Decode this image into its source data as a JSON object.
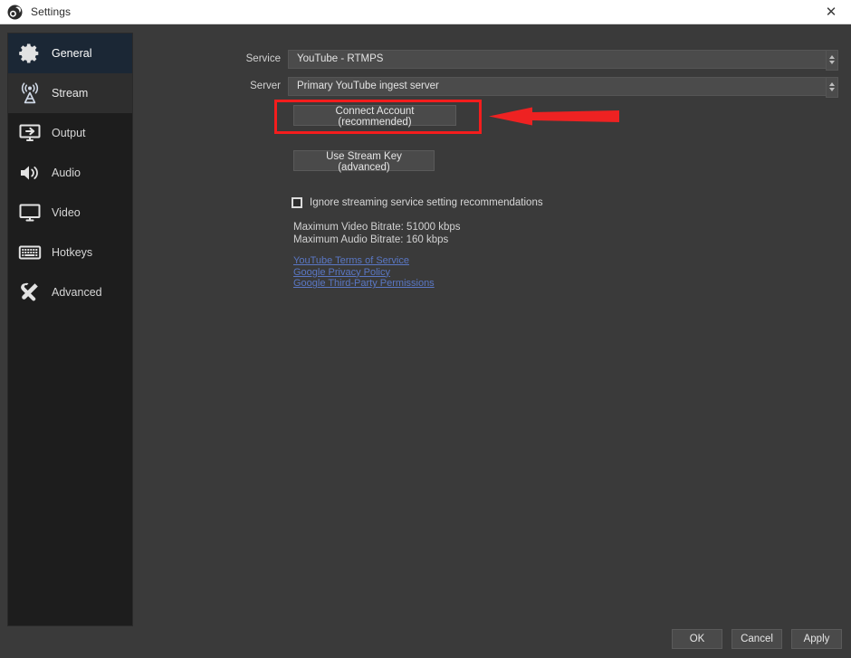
{
  "window": {
    "title": "Settings",
    "logo_icon": "obs-logo-icon",
    "close_icon": "close-icon"
  },
  "sidebar": {
    "items": [
      {
        "label": "General",
        "icon": "gear-icon",
        "state": "selected"
      },
      {
        "label": "Stream",
        "icon": "broadcast-icon",
        "state": "hovered"
      },
      {
        "label": "Output",
        "icon": "output-monitor-icon",
        "state": "normal"
      },
      {
        "label": "Audio",
        "icon": "speaker-icon",
        "state": "normal"
      },
      {
        "label": "Video",
        "icon": "monitor-icon",
        "state": "normal"
      },
      {
        "label": "Hotkeys",
        "icon": "keyboard-icon",
        "state": "normal"
      },
      {
        "label": "Advanced",
        "icon": "tools-icon",
        "state": "normal"
      }
    ]
  },
  "stream_settings": {
    "service": {
      "label": "Service",
      "value": "YouTube - RTMPS"
    },
    "server": {
      "label": "Server",
      "value": "Primary YouTube ingest server"
    },
    "connect_account_button": "Connect Account (recommended)",
    "stream_key_button": "Use Stream Key (advanced)",
    "ignore_recommendations": {
      "label": "Ignore streaming service setting recommendations",
      "checked": false
    },
    "max_video_bitrate": "Maximum Video Bitrate: 51000 kbps",
    "max_audio_bitrate": "Maximum Audio Bitrate: 160 kbps",
    "links": [
      "YouTube Terms of Service",
      "Google Privacy Policy",
      "Google Third-Party Permissions"
    ]
  },
  "annotations": {
    "highlight_color": "#f41d1d",
    "arrow_color": "#ee2222",
    "target": "Connect Account (recommended)"
  },
  "footer": {
    "ok": "OK",
    "cancel": "Cancel",
    "apply": "Apply"
  },
  "colors": {
    "panel_bg": "#3a3a3a",
    "sidebar_bg": "#1d1d1d",
    "selected_bg": "#1b2735",
    "field_bg": "#4b4b4b",
    "link": "#5a77c4"
  }
}
